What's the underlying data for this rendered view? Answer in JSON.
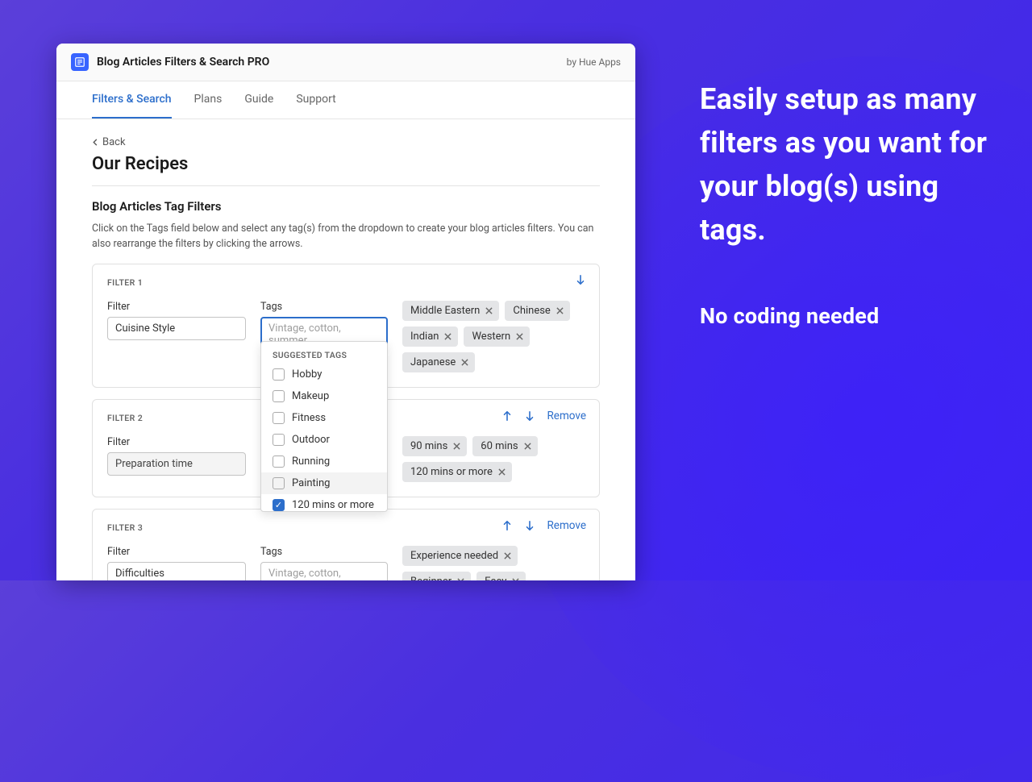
{
  "header": {
    "app_title": "Blog Articles Filters & Search PRO",
    "by_author": "by Hue Apps"
  },
  "tabs": {
    "items": [
      "Filters & Search",
      "Plans",
      "Guide",
      "Support"
    ],
    "active_index": 0
  },
  "back_label": "Back",
  "page_title": "Our Recipes",
  "section": {
    "title": "Blog Articles Tag Filters",
    "description": "Click on the Tags field below and select any tag(s) from the dropdown to create your blog articles filters. You can also rearrange the filters by clicking the arrows."
  },
  "labels": {
    "filter_field": "Filter",
    "tags_field": "Tags",
    "remove": "Remove",
    "suggested_tags": "SUGGESTED TAGS"
  },
  "tags_placeholder": "Vintage, cotton, summer",
  "filters": [
    {
      "card_label": "FILTER 1",
      "name": "Cuisine Style",
      "editable": true,
      "focused": true,
      "show_actions_down_only": true,
      "chips": [
        "Middle Eastern",
        "Chinese",
        "Indian",
        "Western",
        "Japanese"
      ]
    },
    {
      "card_label": "FILTER 2",
      "name": "Preparation time",
      "editable": false,
      "chips": [
        "90 mins",
        "60 mins",
        "120 mins or more"
      ]
    },
    {
      "card_label": "FILTER 3",
      "name": "Difficulties",
      "editable": true,
      "chips": [
        "Experience needed",
        "Beginner",
        "Easy"
      ]
    }
  ],
  "dropdown": {
    "items": [
      {
        "label": "Hobby",
        "checked": false
      },
      {
        "label": "Makeup",
        "checked": false
      },
      {
        "label": "Fitness",
        "checked": false
      },
      {
        "label": "Outdoor",
        "checked": false
      },
      {
        "label": "Running",
        "checked": false
      },
      {
        "label": "Painting",
        "checked": false,
        "hover": true
      },
      {
        "label": "120 mins or more",
        "checked": true
      }
    ]
  },
  "marketing": {
    "headline": "Easily setup as many filters as you want for your blog(s) using tags.",
    "subline": "No coding needed"
  }
}
